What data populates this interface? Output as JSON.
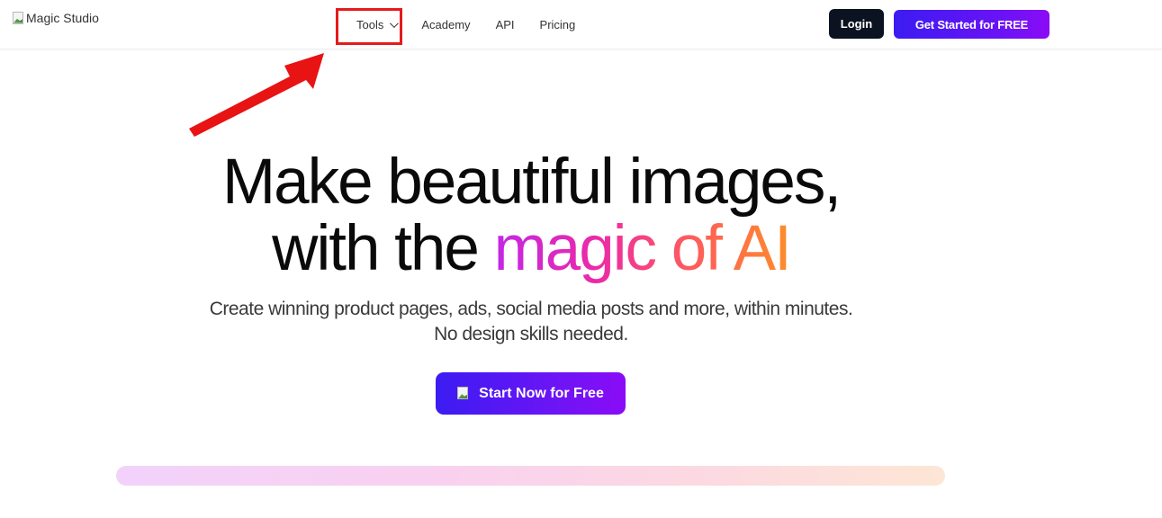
{
  "nav": {
    "logo_alt": "Magic Studio",
    "menu": [
      {
        "label": "Tools",
        "has_dropdown": true
      },
      {
        "label": "Academy"
      },
      {
        "label": "API"
      },
      {
        "label": "Pricing"
      }
    ],
    "login_label": "Login",
    "get_started_label": "Get Started for FREE"
  },
  "hero": {
    "headline_line1": "Make beautiful images,",
    "headline_line2_plain": "with the ",
    "headline_line2_gradient": "magic of AI",
    "subtitle_line1": "Create winning product pages, ads, social media posts and more, within minutes.",
    "subtitle_line2": "No design skills needed.",
    "cta_label": "Start Now for Free"
  },
  "annotation": {
    "highlight_color": "#e51b1b",
    "target": "Tools"
  },
  "colors": {
    "primary_gradient_start": "#3b1cf2",
    "primary_gradient_end": "#8a0cf6",
    "login_bg": "#0b1320"
  }
}
